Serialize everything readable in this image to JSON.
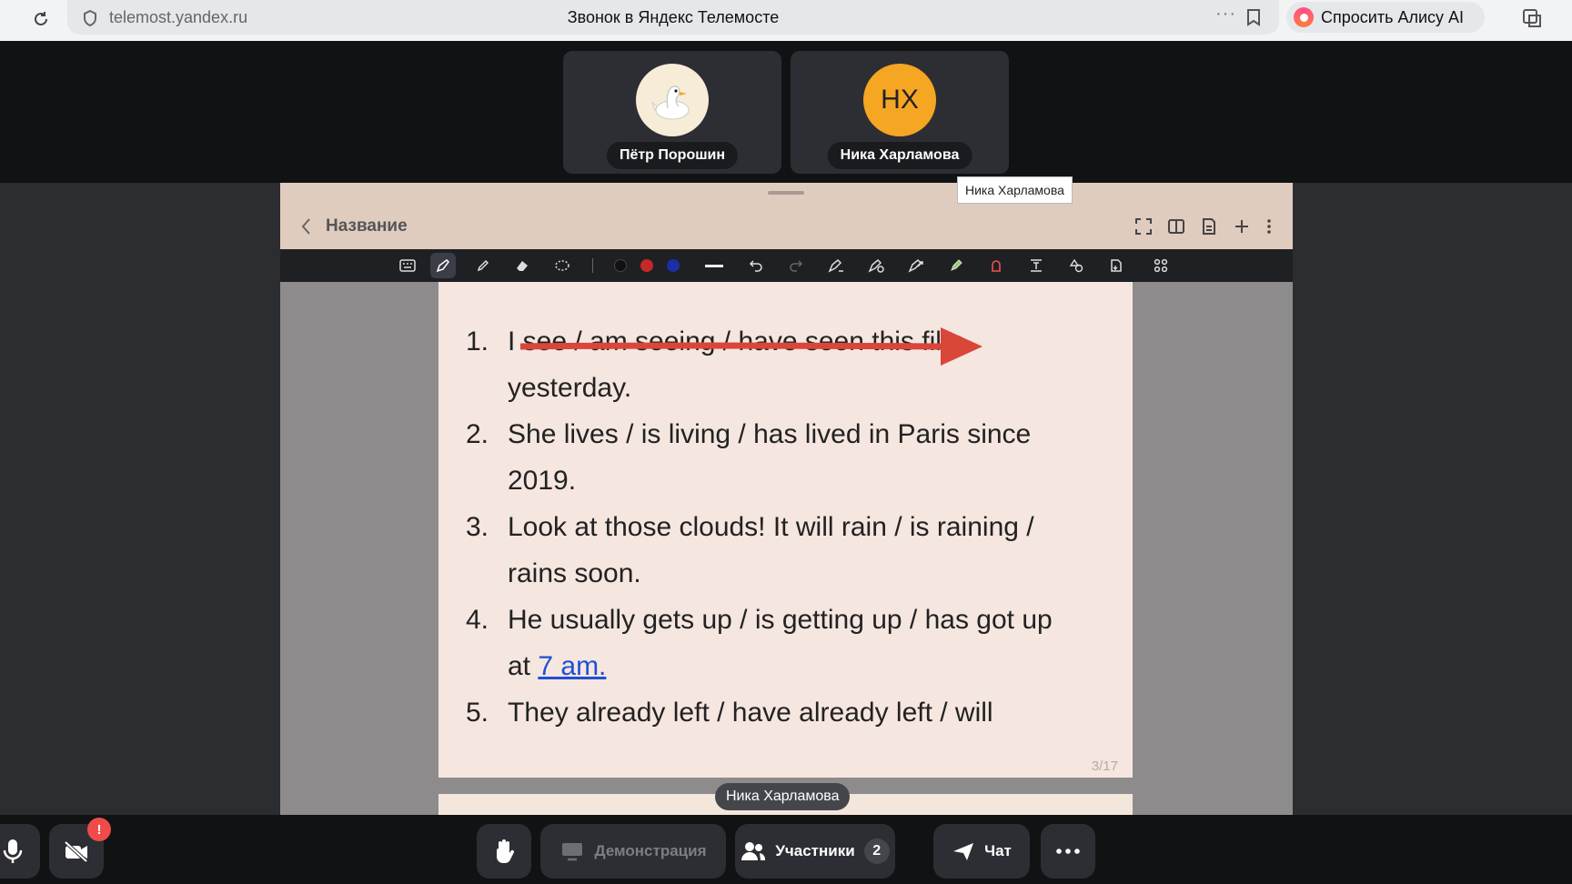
{
  "browser": {
    "url": "telemost.yandex.ru",
    "title": "Звонок в Яндекс Телемосте",
    "alice_label": "Спросить Алису AI",
    "more": "···"
  },
  "participants": [
    {
      "name": "Пётр Порошин",
      "avatar": "duck",
      "color": "#f6ecd8"
    },
    {
      "name": "Ника Харламова",
      "initials": "НХ",
      "color": "#f5a623"
    }
  ],
  "tooltip": "Ника Харламова",
  "board": {
    "title": "Название",
    "page_number": "3/17",
    "colors": [
      "#111111",
      "#c62828",
      "#1a2fa8"
    ],
    "exercises": [
      {
        "num": "1.",
        "lines": [
          "I see / am seeing / have seen this film",
          "yesterday."
        ]
      },
      {
        "num": "2.",
        "lines": [
          "She lives / is living / has lived in Paris since",
          "2019."
        ]
      },
      {
        "num": "3.",
        "lines": [
          "Look at those clouds! It will rain / is raining /",
          "rains soon."
        ]
      },
      {
        "num": "4.",
        "lines": [
          "He usually gets up / is getting up / has got up"
        ],
        "last_prefix": "at ",
        "last_link": "7 am."
      },
      {
        "num": "5.",
        "lines": [
          "They already left / have already left / will"
        ]
      }
    ]
  },
  "active_speaker": "Ника Харламова",
  "controls": {
    "demo": "Демонстрация",
    "participants": "Участники",
    "participants_count": "2",
    "chat": "Чат",
    "camera_alert": "!"
  }
}
